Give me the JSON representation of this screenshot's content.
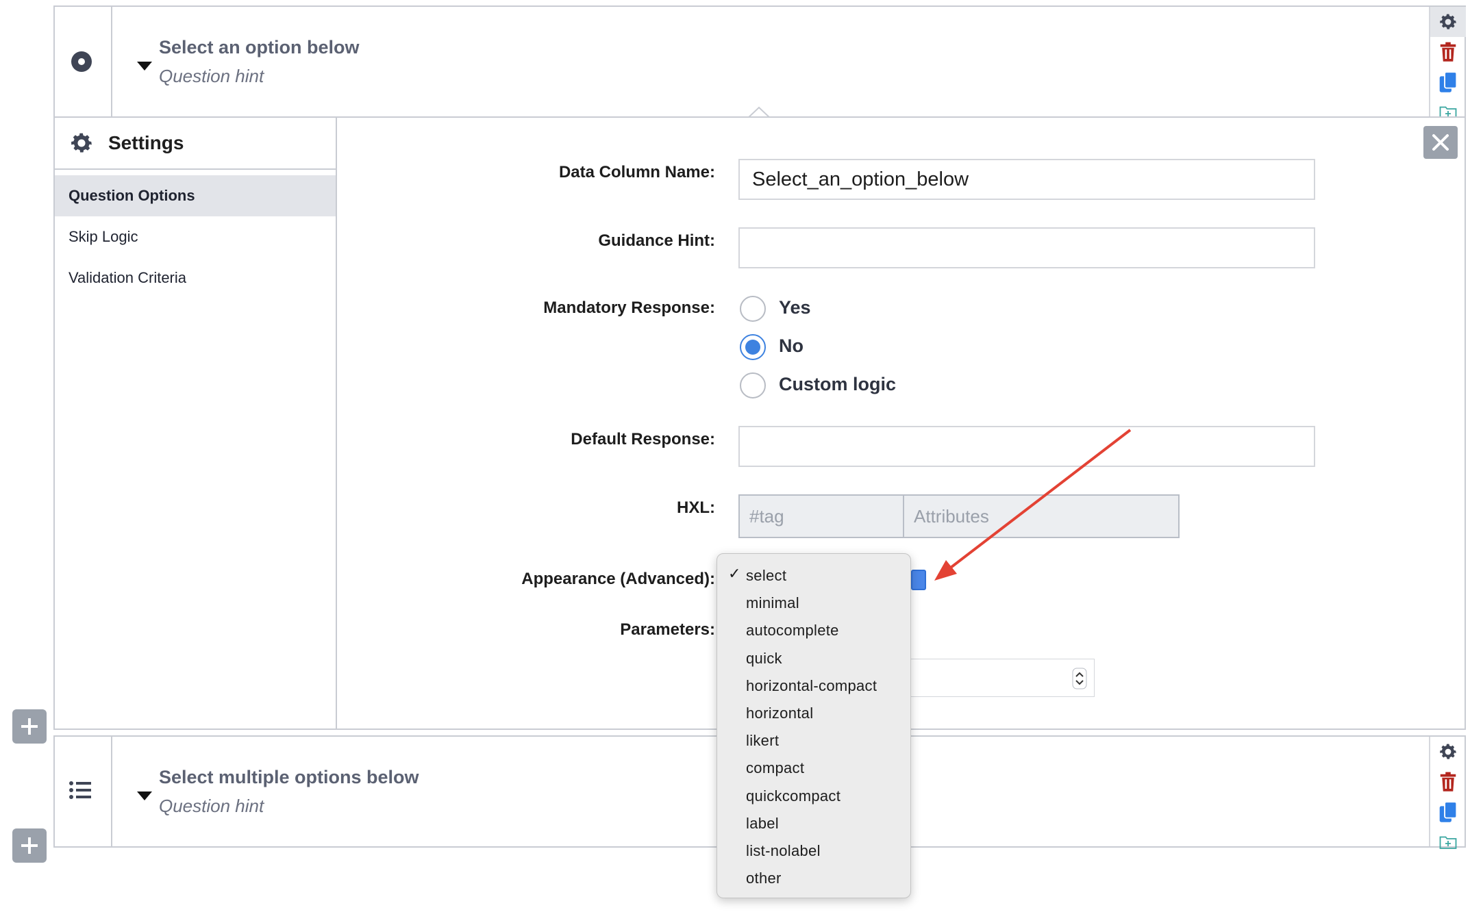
{
  "question1": {
    "title": "Select an option below",
    "hint": "Question hint",
    "type_icon": "radio-button-icon"
  },
  "settings": {
    "heading": "Settings",
    "nav": [
      {
        "label": "Question Options",
        "active": true
      },
      {
        "label": "Skip Logic",
        "active": false
      },
      {
        "label": "Validation Criteria",
        "active": false
      }
    ],
    "fields": {
      "data_column_label": "Data Column Name:",
      "data_column_value": "Select_an_option_below",
      "guidance_label": "Guidance Hint:",
      "guidance_value": "",
      "mandatory_label": "Mandatory Response:",
      "mandatory_options": [
        {
          "label": "Yes",
          "selected": false
        },
        {
          "label": "No",
          "selected": true
        },
        {
          "label": "Custom logic",
          "selected": false
        }
      ],
      "default_label": "Default Response:",
      "default_value": "",
      "hxl_label": "HXL:",
      "hxl_tag_placeholder": "#tag",
      "hxl_attr_placeholder": "Attributes",
      "appearance_label": "Appearance (Advanced):",
      "parameters_label": "Parameters:"
    }
  },
  "appearance_menu": {
    "selected": "select",
    "check_glyph": "✓",
    "options": [
      "select",
      "minimal",
      "autocomplete",
      "quick",
      "horizontal-compact",
      "horizontal",
      "likert",
      "compact",
      "quickcompact",
      "label",
      "list-nolabel",
      "other"
    ]
  },
  "question2": {
    "title": "Select multiple options below",
    "hint": "Question hint",
    "type_icon": "list-icon"
  },
  "colors": {
    "delete_red": "#b3261e",
    "copy_blue": "#2f80e8",
    "radio_blue": "#3d82e0",
    "annotation_arrow": "#e34234"
  }
}
